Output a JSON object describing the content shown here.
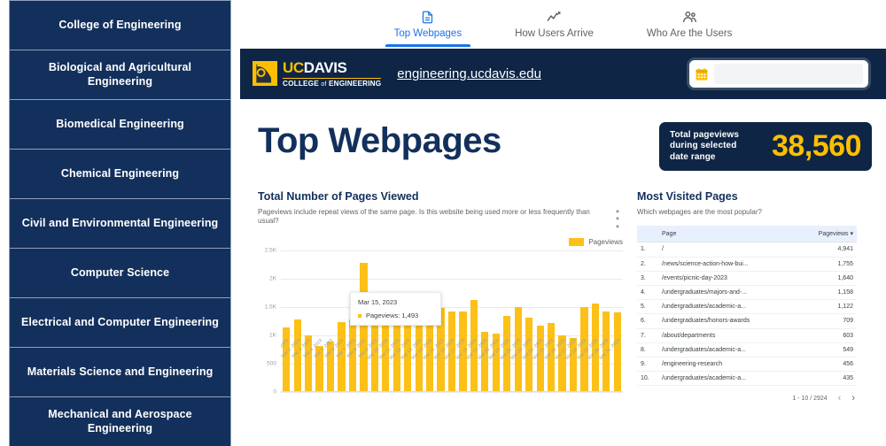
{
  "sidebar": {
    "items": [
      {
        "label": "College of Engineering"
      },
      {
        "label": "Biological and Agricultural Engineering"
      },
      {
        "label": "Biomedical Engineering"
      },
      {
        "label": "Chemical Engineering"
      },
      {
        "label": "Civil and Environmental Engineering"
      },
      {
        "label": "Computer Science"
      },
      {
        "label": "Electrical and Computer Engineering"
      },
      {
        "label": "Materials Science and Engineering"
      },
      {
        "label": "Mechanical and Aerospace Engineering"
      }
    ]
  },
  "tabs": [
    {
      "label": "Top Webpages",
      "icon": "document-icon",
      "active": true
    },
    {
      "label": "How Users Arrive",
      "icon": "trending-chart-icon",
      "active": false
    },
    {
      "label": "Who Are the Users",
      "icon": "people-icon",
      "active": false
    }
  ],
  "header": {
    "logo_uc": "UC",
    "logo_davis": "DAVIS",
    "logo_college": "COLLEGE",
    "logo_of": "of",
    "logo_engineering": "ENGINEERING",
    "site_url": "engineering.ucdavis.edu",
    "date_picker_value": "",
    "date_picker_icon": "calendar-icon"
  },
  "main": {
    "page_title": "Top Webpages",
    "kpi_label": "Total pageviews during selected date range",
    "kpi_value": "38,560"
  },
  "chart_panel": {
    "title": "Total Number of Pages Viewed",
    "subtitle": "Pageviews include repeat views of the same page. Is this website being used more or less frequently than usual?",
    "legend_label": "Pageviews",
    "tooltip_date": "Mar 15, 2023",
    "tooltip_value": "Pageviews: 1,493"
  },
  "table_panel": {
    "title": "Most Visited Pages",
    "subtitle": "Which webpages are the most popular?",
    "columns": [
      "",
      "Page",
      "Pageviews"
    ],
    "sort_indicator": "▾",
    "rows": [
      {
        "rank": "1.",
        "page": "/",
        "views": "4,941"
      },
      {
        "rank": "2.",
        "page": "/news/science-action-how-bui...",
        "views": "1,755"
      },
      {
        "rank": "3.",
        "page": "/events/picnic-day-2023",
        "views": "1,640"
      },
      {
        "rank": "4.",
        "page": "/undergraduates/majors-and-...",
        "views": "1,158"
      },
      {
        "rank": "5.",
        "page": "/undergraduates/academic-a...",
        "views": "1,122"
      },
      {
        "rank": "6.",
        "page": "/undergraduates/honors-awards",
        "views": "709"
      },
      {
        "rank": "7.",
        "page": "/about/departments",
        "views": "603"
      },
      {
        "rank": "8.",
        "page": "/undergraduates/academic-a...",
        "views": "549"
      },
      {
        "rank": "9.",
        "page": "/engineering-research",
        "views": "456"
      },
      {
        "rank": "10.",
        "page": "/undergraduates/academic-a...",
        "views": "435"
      }
    ],
    "pager_text": "1 - 10 / 2924",
    "prev_label": "‹",
    "next_label": "›"
  },
  "colors": {
    "navy": "#13305c",
    "header_navy": "#0e2545",
    "gold": "#FFBF00",
    "bar_gold": "#FCC017",
    "tab_active": "#1a73e8"
  },
  "chart_data": {
    "type": "bar",
    "title": "Total Number of Pages Viewed",
    "subtitle": "Pageviews include repeat views of the same page. Is this website being used more or less frequently than usual?",
    "xlabel": "",
    "ylabel": "",
    "ylim": [
      0,
      2500
    ],
    "yticks": [
      0,
      500,
      1000,
      1500,
      2000,
      2500
    ],
    "ytick_labels": [
      "0",
      "500",
      "1K",
      "1.5K",
      "2K",
      "2.5K"
    ],
    "grid": true,
    "legend": [
      "Pageviews"
    ],
    "legend_position": "top-right",
    "series_color": "#FCC017",
    "categories": [
      "Mar 1, 2023",
      "Mar 2, 2023",
      "Mar 3, 2023",
      "Mar 4, 2023",
      "Mar 5, 2023",
      "Mar 6, 2023",
      "Mar 7, 2023",
      "Mar 8, 2023",
      "Mar 9, 2023",
      "Mar 10, 2023",
      "Mar 11, 2023",
      "Mar 12, 2023",
      "Mar 13, 2023",
      "Mar 14, 2023",
      "Mar 15, 2023",
      "Mar 16, 2023",
      "Mar 17, 2023",
      "Mar 18, 2023",
      "Mar 19, 2023",
      "Mar 20, 2023",
      "Mar 21, 2023",
      "Mar 22, 2023",
      "Mar 23, 2023",
      "Mar 24, 2023",
      "Mar 25, 2023",
      "Mar 26, 2023",
      "Mar 27, 2023",
      "Mar 28, 2023",
      "Mar 29, 2023",
      "Mar 30, 2023",
      "Mar 31, 2023"
    ],
    "values": [
      1150,
      1280,
      1010,
      820,
      900,
      1230,
      1290,
      2290,
      1620,
      1620,
      1270,
      1490,
      1190,
      1330,
      1493,
      1420,
      1430,
      1630,
      1070,
      1040,
      1340,
      1500,
      1310,
      1180,
      1220,
      1010,
      960,
      1510,
      1560,
      1430,
      1410
    ],
    "annotations": [
      {
        "type": "tooltip",
        "category": "Mar 15, 2023",
        "label": "Pageviews: 1,493",
        "value": 1493
      }
    ]
  }
}
